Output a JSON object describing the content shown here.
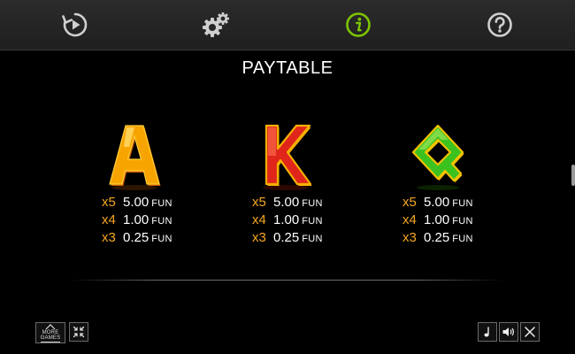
{
  "title": "PAYTABLE",
  "top_icons": [
    "replay-icon",
    "settings-gears-icon",
    "info-icon",
    "help-icon"
  ],
  "active_icon": "info-icon",
  "accent_color": "#7dc300",
  "multiplier_color": "#f5a623",
  "symbols": [
    {
      "letter": "A",
      "colors": {
        "fill": "#f7a400",
        "edge": "#c45800",
        "highlight": "#ffe27a"
      },
      "pays": [
        {
          "mult": "x5",
          "value": "5.00",
          "currency": "FUN"
        },
        {
          "mult": "x4",
          "value": "1.00",
          "currency": "FUN"
        },
        {
          "mult": "x3",
          "value": "0.25",
          "currency": "FUN"
        }
      ]
    },
    {
      "letter": "K",
      "colors": {
        "fill": "#e0261b",
        "edge": "#f5b000",
        "highlight": "#ff7a55"
      },
      "pays": [
        {
          "mult": "x5",
          "value": "5.00",
          "currency": "FUN"
        },
        {
          "mult": "x4",
          "value": "1.00",
          "currency": "FUN"
        },
        {
          "mult": "x3",
          "value": "0.25",
          "currency": "FUN"
        }
      ]
    },
    {
      "letter": "Q",
      "colors": {
        "fill": "#3cc21f",
        "edge": "#f2c200",
        "highlight": "#b6f26a"
      },
      "pays": [
        {
          "mult": "x5",
          "value": "5.00",
          "currency": "FUN"
        },
        {
          "mult": "x4",
          "value": "1.00",
          "currency": "FUN"
        },
        {
          "mult": "x3",
          "value": "0.25",
          "currency": "FUN"
        }
      ]
    }
  ],
  "bottom_left": {
    "more_games_label": "MORE\nGAMES",
    "buttons": [
      "home-icon",
      "minimize-icon"
    ]
  },
  "bottom_right": {
    "buttons": [
      "music-note-icon",
      "speaker-icon",
      "close-icon"
    ]
  }
}
